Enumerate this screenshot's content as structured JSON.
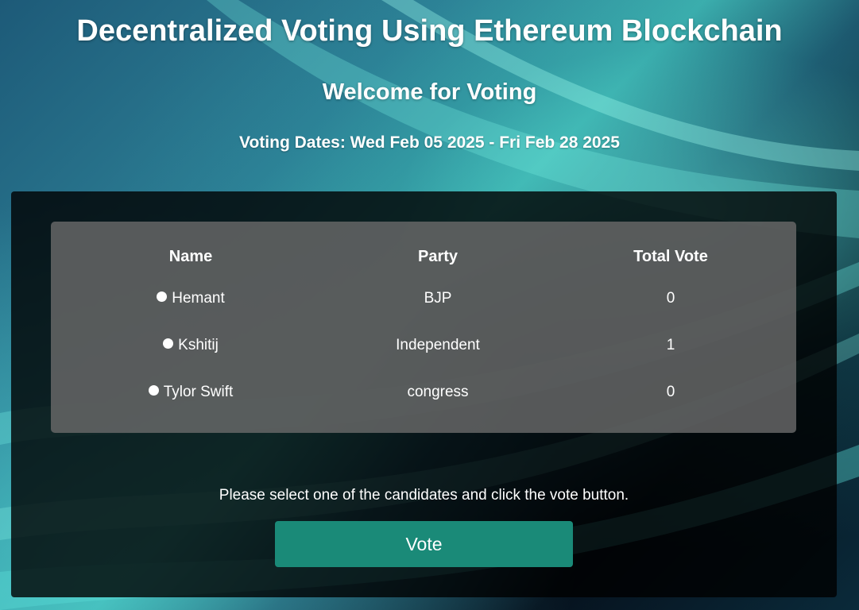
{
  "header": {
    "title": "Decentralized Voting Using Ethereum Blockchain",
    "subtitle": "Welcome for Voting",
    "dates_label": "Voting Dates:",
    "dates_value": "Wed Feb 05 2025 - Fri Feb 28 2025"
  },
  "table": {
    "headers": [
      "Name",
      "Party",
      "Total Vote"
    ],
    "rows": [
      {
        "name": "Hemant",
        "party": "BJP",
        "votes": "0"
      },
      {
        "name": "Kshitij",
        "party": "Independent",
        "votes": "1"
      },
      {
        "name": "Tylor Swift",
        "party": "congress",
        "votes": "0"
      }
    ]
  },
  "instructions": "Please select one of the candidates and click the vote button.",
  "vote_button": {
    "label": "Vote"
  },
  "colors": {
    "accent": "#1a8a78",
    "panel": "#000000",
    "table_bg": "#696969"
  }
}
